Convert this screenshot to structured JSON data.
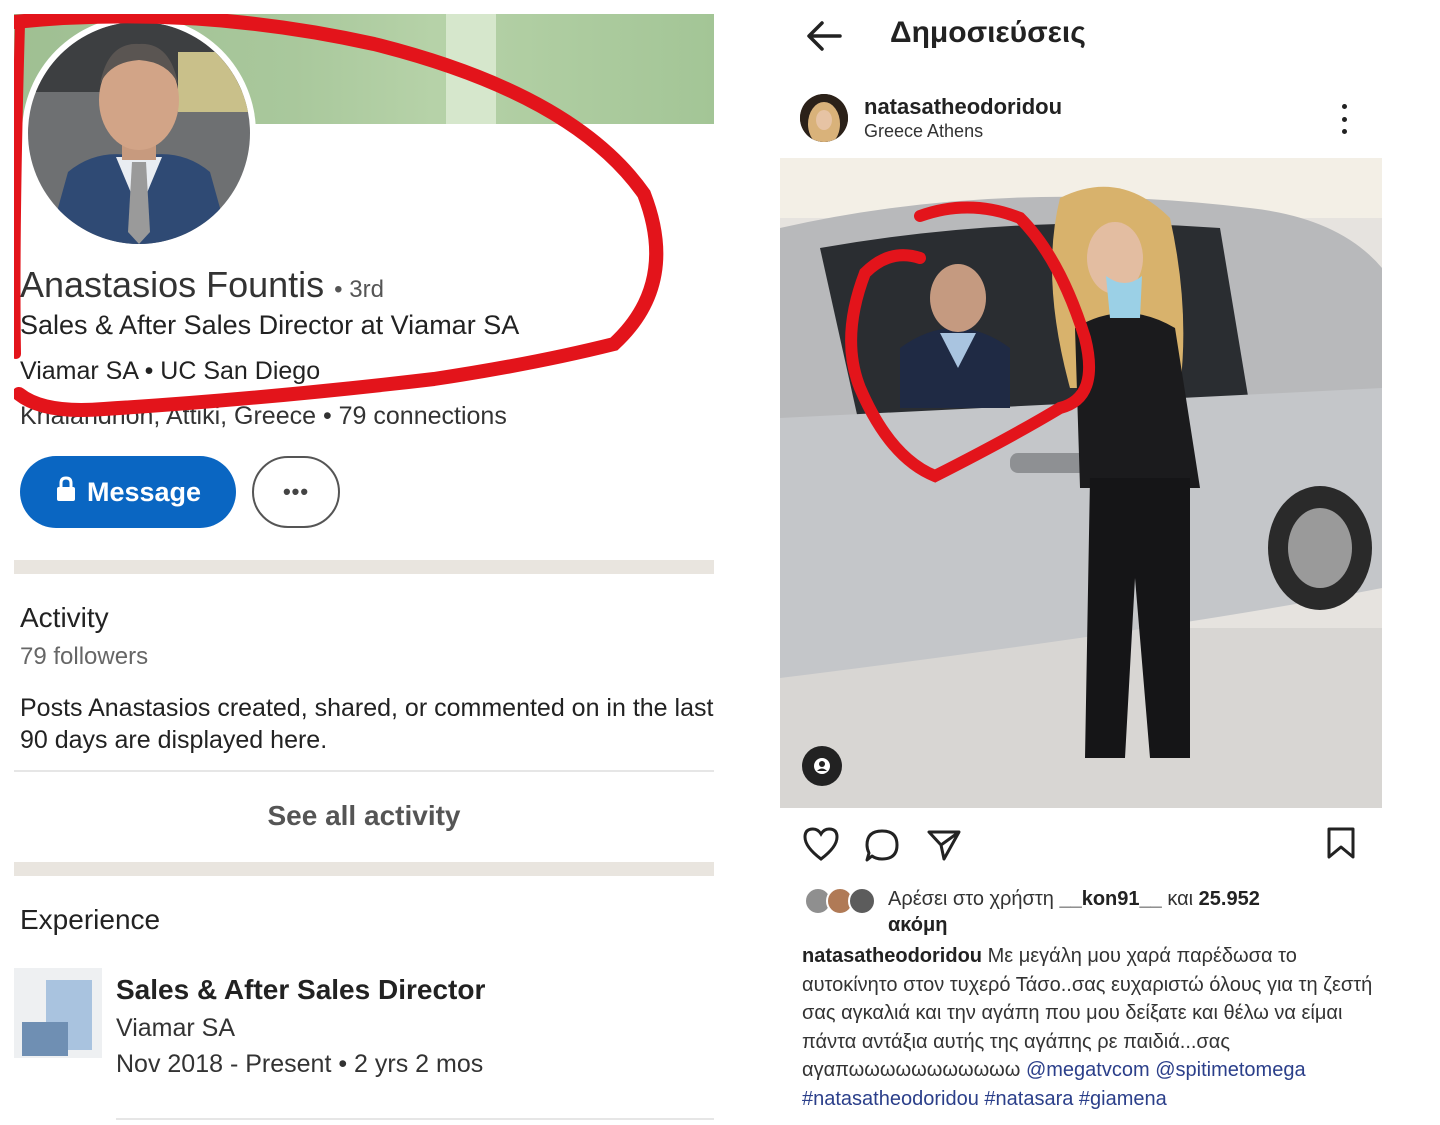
{
  "linkedin": {
    "name": "Anastasios Fountis",
    "degree": "• 3rd",
    "headline": "Sales & After Sales Director at Viamar SA",
    "education": "Viamar SA • UC San Diego",
    "location": "Khalandrion, Attiki, Greece • 79 connections",
    "message_button": "Message",
    "more_button": "•••",
    "activity": {
      "title": "Activity",
      "followers": "79 followers",
      "description": "Posts Anastasios created, shared, or commented on in the last 90 days are displayed here.",
      "see_all": "See all activity"
    },
    "experience": {
      "title": "Experience",
      "role": "Sales & After Sales Director",
      "company": "Viamar SA",
      "dates": "Nov 2018 - Present • 2 yrs 2 mos"
    },
    "accent_color": "#0a66c2"
  },
  "instagram": {
    "header_title": "Δημοσιεύσεις",
    "username": "natasatheodoridou",
    "location": "Greece Athens",
    "likes_prefix": "Αρέσει στο χρήστη",
    "likes_user": "__kon91__",
    "likes_and": "και",
    "likes_count": "25.952",
    "likes_suffix": "ακόμη",
    "caption_user": "natasatheodoridou",
    "caption_text": " Με μεγάλη μου χαρά παρέδωσα το αυτοκίνητο στον τυχερό Τάσο..σας ευχαριστώ όλους για τη ζεστή σας αγκαλιά και την αγάπη που μου δείξατε και θέλω να είμαι πάντα αντάξια αυτής της αγάπης ρε παιδιά...σας αγαπωωωωωωωωωωω ",
    "caption_tags": [
      "@megatvcom",
      "@spitimetomega",
      "#natasatheodoridou",
      "#natasara",
      "#giamena"
    ]
  },
  "annotation_color": "#e3141b"
}
